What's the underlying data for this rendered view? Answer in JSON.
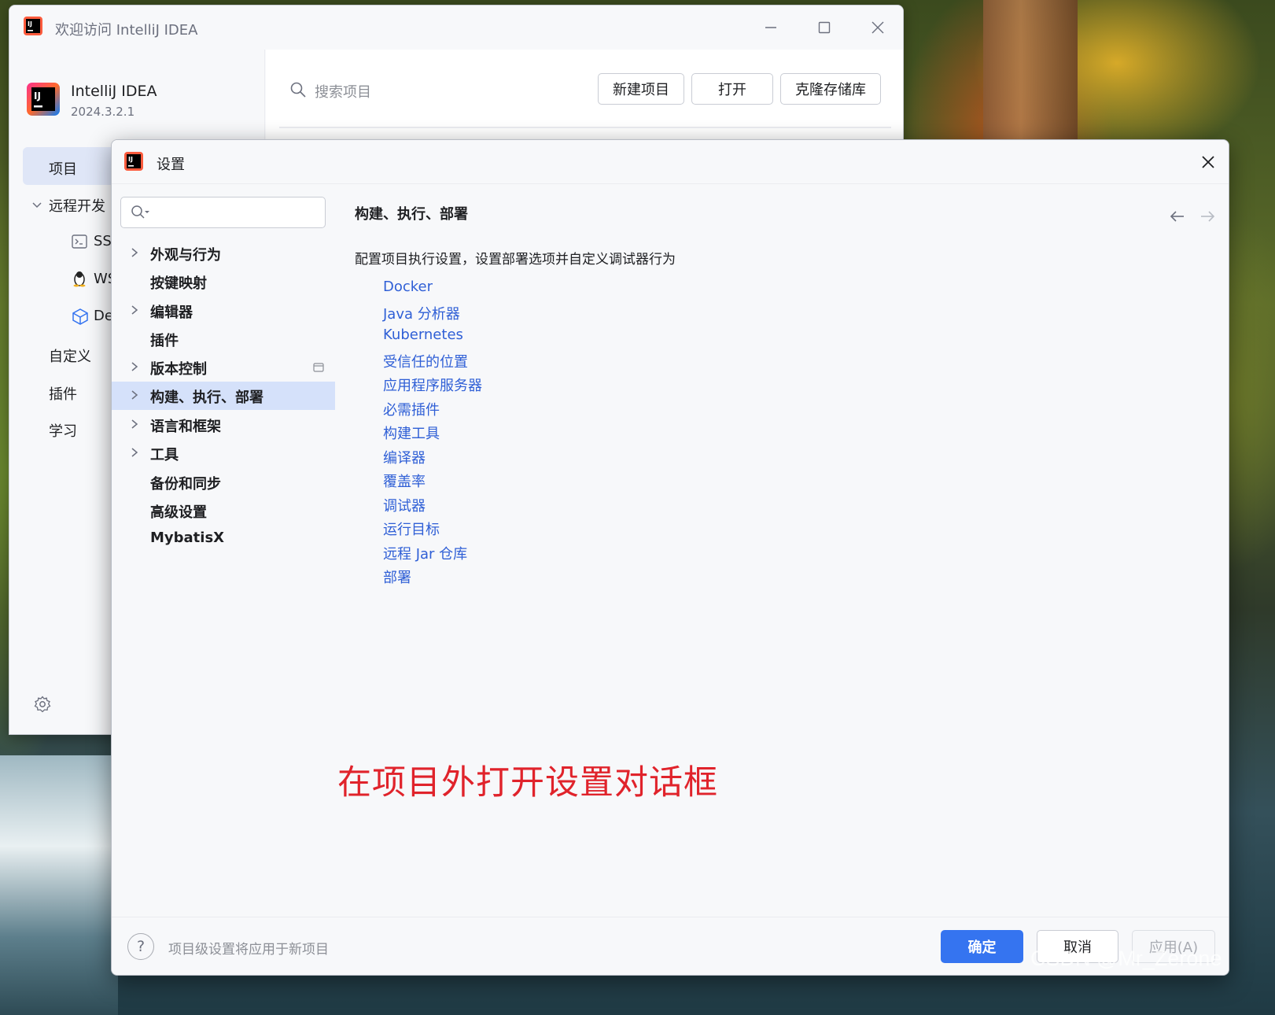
{
  "welcome": {
    "window_title": "欢迎访问 IntelliJ IDEA",
    "product_name": "IntelliJ IDEA",
    "product_version": "2024.3.2.1",
    "nav": {
      "projects": "项目",
      "remote_dev": "远程开发",
      "ssh": "SSH",
      "wsl": "WSL",
      "dev_containers": "De",
      "customize": "自定义",
      "plugins": "插件",
      "learn": "学习"
    },
    "search_placeholder": "搜索项目",
    "buttons": {
      "new_project": "新建项目",
      "open": "打开",
      "clone": "克隆存储库"
    }
  },
  "settings": {
    "title": "设置",
    "tree": [
      {
        "label": "外观与行为",
        "expandable": true
      },
      {
        "label": "按键映射",
        "expandable": false
      },
      {
        "label": "编辑器",
        "expandable": true
      },
      {
        "label": "插件",
        "expandable": false
      },
      {
        "label": "版本控制",
        "expandable": true
      },
      {
        "label": "构建、执行、部署",
        "expandable": true,
        "selected": true
      },
      {
        "label": "语言和框架",
        "expandable": true
      },
      {
        "label": "工具",
        "expandable": true
      },
      {
        "label": "备份和同步",
        "expandable": false
      },
      {
        "label": "高级设置",
        "expandable": false
      },
      {
        "label": "MybatisX",
        "expandable": false
      }
    ],
    "content": {
      "heading": "构建、执行、部署",
      "description": "配置项目执行设置，设置部署选项并自定义调试器行为",
      "links": [
        "Docker",
        "Java 分析器",
        "Kubernetes",
        "受信任的位置",
        "应用程序服务器",
        "必需插件",
        "构建工具",
        "编译器",
        "覆盖率",
        "调试器",
        "运行目标",
        "远程 Jar 仓库",
        "部署"
      ]
    },
    "footer": {
      "help": "?",
      "note": "项目级设置将应用于新项目",
      "ok": "确定",
      "cancel": "取消",
      "apply": "应用(A)"
    }
  },
  "annotation": "在项目外打开设置对话框",
  "watermark": "CSDN @Mr_Zerone",
  "colors": {
    "accent": "#3574f0",
    "link": "#2f5fd6",
    "selection": "#d5e1fa",
    "annotation": "#e0232b"
  }
}
